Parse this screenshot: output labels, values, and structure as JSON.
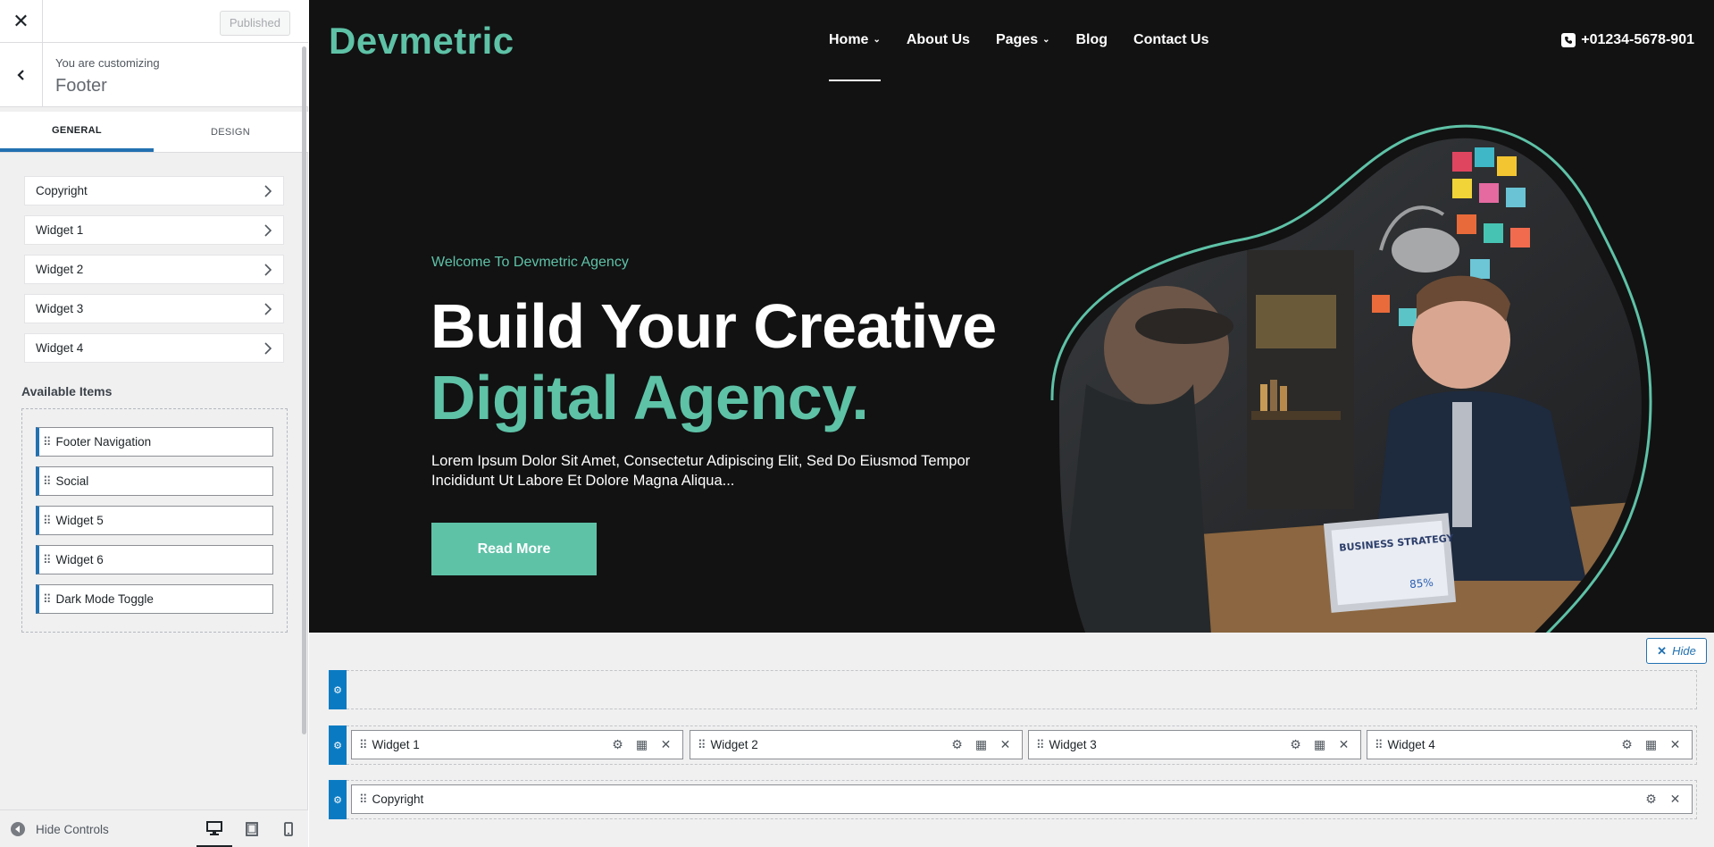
{
  "sidebar": {
    "published_label": "Published",
    "customizing_label": "You are customizing",
    "section_title": "Footer",
    "tabs": [
      {
        "label": "GENERAL",
        "active": true
      },
      {
        "label": "DESIGN",
        "active": false
      }
    ],
    "sections": [
      "Copyright",
      "Widget 1",
      "Widget 2",
      "Widget 3",
      "Widget 4"
    ],
    "available_title": "Available Items",
    "available_items": [
      "Footer Navigation",
      "Social",
      "Widget 5",
      "Widget 6",
      "Dark Mode Toggle"
    ],
    "hide_controls_label": "Hide Controls",
    "devices": [
      "desktop",
      "tablet",
      "mobile"
    ]
  },
  "site": {
    "logo": "Devmetric",
    "nav": [
      {
        "label": "Home",
        "dropdown": true,
        "active": true
      },
      {
        "label": "About Us",
        "dropdown": false
      },
      {
        "label": "Pages",
        "dropdown": true
      },
      {
        "label": "Blog",
        "dropdown": false
      },
      {
        "label": "Contact Us",
        "dropdown": false
      }
    ],
    "phone": "+01234-5678-901",
    "hero": {
      "subtitle": "Welcome To Devmetric Agency",
      "title_line1": "Build Your Creative",
      "title_line2": "Digital Agency.",
      "paragraph": "Lorem Ipsum Dolor Sit Amet, Consectetur Adipiscing Elit, Sed Do Eiusmod Tempor Incididunt Ut Labore Et Dolore Magna Aliqua...",
      "button": "Read More",
      "image_text": "BUSINESS STRATEGY",
      "image_stat": "85%"
    }
  },
  "builder": {
    "hide_label": "Hide",
    "middle_row": [
      "Widget 1",
      "Widget 2",
      "Widget 3",
      "Widget 4"
    ],
    "bottom_row": [
      "Copyright"
    ]
  },
  "colors": {
    "accent": "#5ec2a7",
    "wp_blue": "#2271b1",
    "hero_bg": "#121212"
  }
}
